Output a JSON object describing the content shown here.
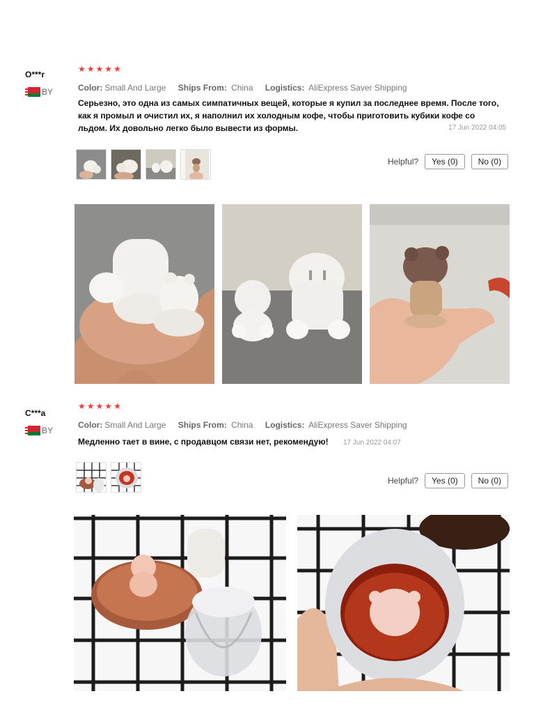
{
  "reviews": [
    {
      "user": "O***r",
      "country": "BY",
      "stars": 5,
      "color_label": "Color:",
      "color_value": "Small And Large",
      "ships_label": "Ships From:",
      "ships_value": "China",
      "logistics_label": "Logistics:",
      "logistics_value": "AliExpress Saver Shipping",
      "text": "Серьезно, это одна из самых симпатичных вещей, которые я купил за последнее время. После того, как я промыл и очистил их, я наполнил их холодным кофе, чтобы приготовить кубики кофе со льдом. Их довольно легко было вывести из формы.",
      "date": "17 Jun 2022 04:05",
      "helpful_label": "Helpful?",
      "yes_label": "Yes (0)",
      "no_label": "No (0)"
    },
    {
      "user": "C***a",
      "country": "BY",
      "stars": 5,
      "color_label": "Color:",
      "color_value": "Small And Large",
      "ships_label": "Ships From:",
      "ships_value": "China",
      "logistics_label": "Logistics:",
      "logistics_value": "AliExpress Saver Shipping",
      "text": "Медленно тает в вине, с продавцом связи нет, рекомендую!",
      "date": "17 Jun 2022 04:07",
      "helpful_label": "Helpful?",
      "yes_label": "Yes (0)",
      "no_label": "No (0)"
    }
  ],
  "icons": {
    "star": "star-icon",
    "flag": "belarus-flag-icon"
  },
  "colors": {
    "star": "#f23b3b",
    "text": "#111111",
    "meta": "#777777"
  }
}
